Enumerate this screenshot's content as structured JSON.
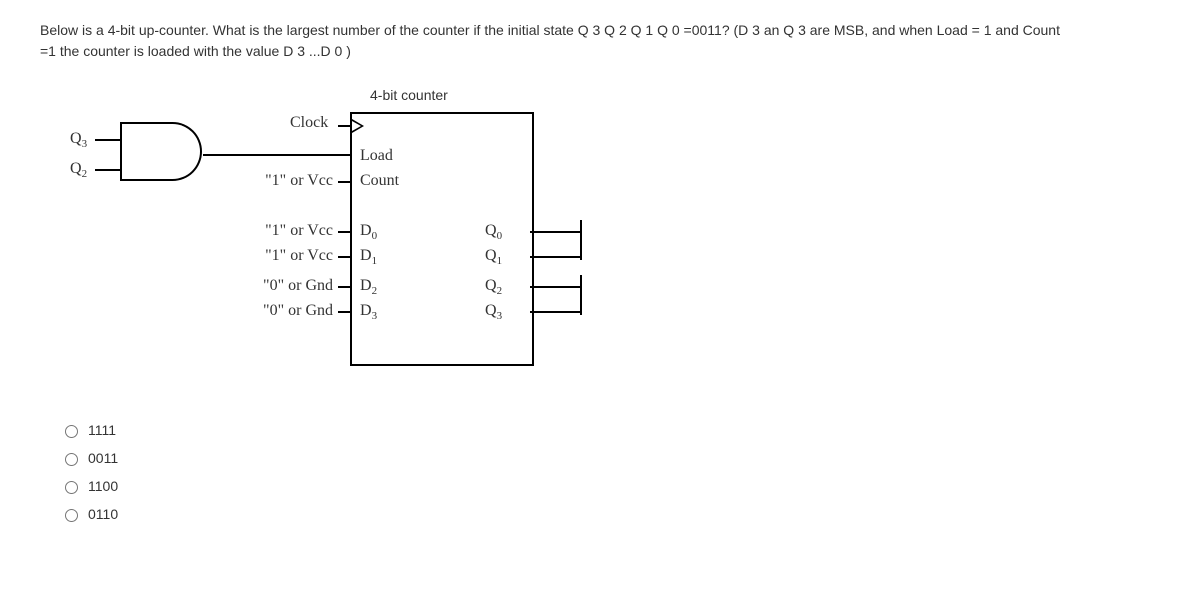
{
  "question": {
    "line1": "Below is a 4-bit up-counter. What is the largest number of the counter if the initial state Q 3 Q 2 Q 1 Q 0 =0011?  (D 3 an Q 3 are MSB, and when Load = 1 and Count",
    "line2": "=1 the counter is loaded with the value D 3 ...D 0 )"
  },
  "diagram": {
    "title": "4-bit counter",
    "clock": "Clock",
    "load": "Load",
    "count": "Count",
    "vcc": "\"1\" or Vcc",
    "gnd": "\"0\" or Gnd",
    "d0": "D",
    "d0s": "0",
    "d1": "D",
    "d1s": "1",
    "d2": "D",
    "d2s": "2",
    "d3": "D",
    "d3s": "3",
    "q0": "Q",
    "q0s": "0",
    "q1": "Q",
    "q1s": "1",
    "q2": "Q",
    "q2s": "2",
    "q3": "Q",
    "q3s": "3",
    "gate_in1": "Q",
    "gate_in1s": "3",
    "gate_in2": "Q",
    "gate_in2s": "2"
  },
  "options": {
    "a": "1111",
    "b": "0011",
    "c": "1100",
    "d": "0110"
  }
}
